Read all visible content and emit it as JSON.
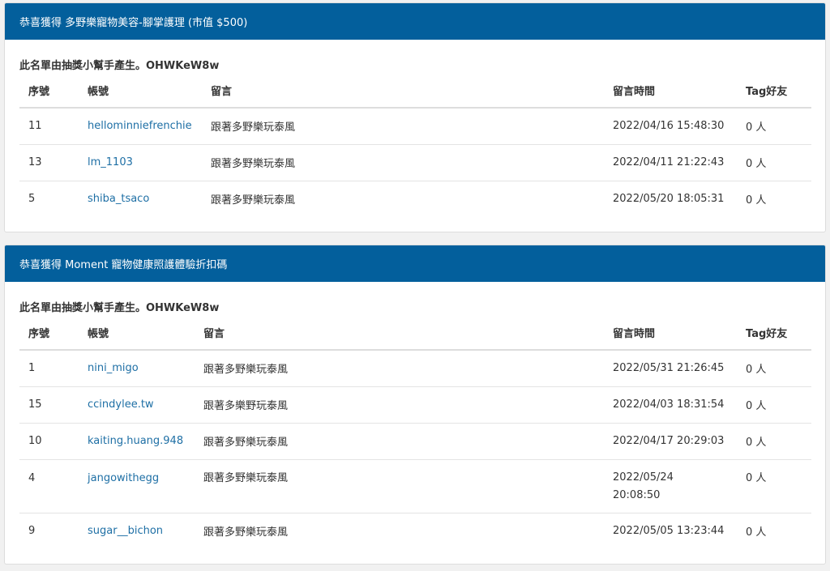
{
  "cards": [
    {
      "header": "恭喜獲得 多野樂寵物美容-腳掌護理 (市值 $500)",
      "note": "此名單由抽獎小幫手產生。OHWKeW8w",
      "columns": [
        "序號",
        "帳號",
        "留言",
        "留言時間",
        "Tag好友"
      ],
      "rows": [
        {
          "no": "11",
          "account": "hellominniefrenchie",
          "message": "跟著多野樂玩泰風",
          "time": "2022/04/16 15:48:30",
          "tags": "0 人"
        },
        {
          "no": "13",
          "account": "lm_1103",
          "message": "跟著多野樂玩泰風",
          "time": "2022/04/11 21:22:43",
          "tags": "0 人"
        },
        {
          "no": "5",
          "account": "shiba_tsaco",
          "message": "跟著多野樂玩泰風",
          "time": "2022/05/20 18:05:31",
          "tags": "0 人"
        }
      ]
    },
    {
      "header": "恭喜獲得 Moment 寵物健康照護體驗折扣碼",
      "note": "此名單由抽獎小幫手產生。OHWKeW8w",
      "columns": [
        "序號",
        "帳號",
        "留言",
        "留言時間",
        "Tag好友"
      ],
      "rows": [
        {
          "no": "1",
          "account": "nini_migo",
          "message": "跟著多野樂玩泰風",
          "time": "2022/05/31 21:26:45",
          "tags": "0 人"
        },
        {
          "no": "15",
          "account": "ccindylee.tw",
          "message": "跟著多樂野玩泰風",
          "time": "2022/04/03 18:31:54",
          "tags": "0 人"
        },
        {
          "no": "10",
          "account": "kaiting.huang.948",
          "message": "跟著多野樂玩泰風",
          "time": "2022/04/17 20:29:03",
          "tags": "0 人"
        },
        {
          "no": "4",
          "account": "jangowithegg",
          "message": "跟著多野樂玩泰風",
          "time_line1": "2022/05/24",
          "time_line2": "20:08:50",
          "tags": "0 人"
        },
        {
          "no": "9",
          "account": "sugar__bichon",
          "message": "跟著多野樂玩泰風",
          "time": "2022/05/05 13:23:44",
          "tags": "0 人"
        }
      ]
    }
  ]
}
